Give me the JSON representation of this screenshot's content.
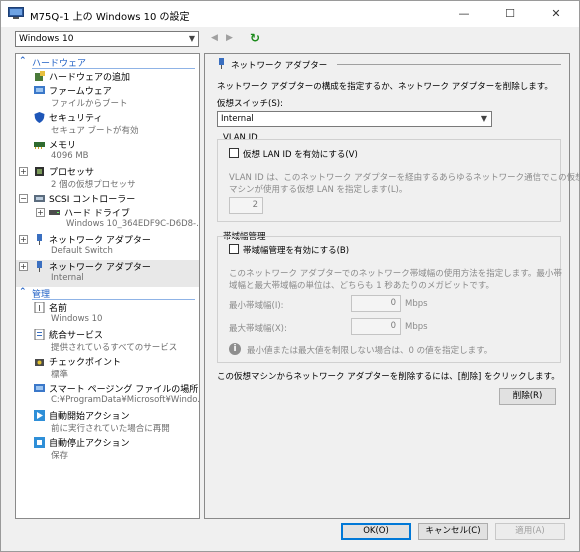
{
  "window": {
    "title": "M75Q-1 上の Windows 10 の設定",
    "min": "—",
    "max": "☐",
    "close": "✕"
  },
  "vm_selector": {
    "value": "Windows 10"
  },
  "nav": {
    "prev": "◀",
    "next": "▶",
    "refresh": "↻"
  },
  "sidebar": {
    "hardware_header": "ハードウェア",
    "management_header": "管理",
    "hardware": [
      {
        "title": "ハードウェアの追加",
        "sub": ""
      },
      {
        "title": "ファームウェア",
        "sub": "ファイルからブート"
      },
      {
        "title": "セキュリティ",
        "sub": "セキュア ブートが有効"
      },
      {
        "title": "メモリ",
        "sub": "4096 MB"
      },
      {
        "title": "プロセッサ",
        "sub": "2 個の仮想プロセッサ"
      },
      {
        "title": "SCSI コントローラー",
        "sub": ""
      },
      {
        "title": "ハード ドライブ",
        "sub": "Windows 10_364EDF9C-D6D8-..."
      },
      {
        "title": "ネットワーク アダプター",
        "sub": "Default Switch"
      },
      {
        "title": "ネットワーク アダプター",
        "sub": "Internal"
      }
    ],
    "management": [
      {
        "title": "名前",
        "sub": "Windows 10"
      },
      {
        "title": "統合サービス",
        "sub": "提供されているすべてのサービス"
      },
      {
        "title": "チェックポイント",
        "sub": "標準"
      },
      {
        "title": "スマート ページング ファイルの場所",
        "sub": "C:¥ProgramData¥Microsoft¥Windo..."
      },
      {
        "title": "自動開始アクション",
        "sub": "前に実行されていた場合に再開"
      },
      {
        "title": "自動停止アクション",
        "sub": "保存"
      }
    ]
  },
  "panel": {
    "header": "ネットワーク アダプター",
    "description": "ネットワーク アダプターの構成を指定するか、ネットワーク アダプターを削除します。",
    "switch_label": "仮想スイッチ(S):",
    "switch_value": "Internal",
    "vlan": {
      "title": "VLAN ID",
      "checkbox": "仮想 LAN ID を有効にする(V)",
      "desc1": "VLAN ID は、このネットワーク アダプターを経由するあらゆるネットワーク通信でこの仮想",
      "desc2": "マシンが使用する仮想 LAN を指定します(L)。",
      "value": "2"
    },
    "bandwidth": {
      "title": "帯域幅管理",
      "checkbox": "帯域幅管理を有効にする(B)",
      "desc1": "このネットワーク アダプターでのネットワーク帯域幅の使用方法を指定します。最小帯",
      "desc2": "域幅と最大帯域幅の単位は、どちらも 1 秒あたりのメガビットです。",
      "min_label": "最小帯域幅(I):",
      "min_value": "0",
      "max_label": "最大帯域幅(X):",
      "max_value": "0",
      "unit": "Mbps",
      "info": "最小値または最大値を制限しない場合は、0 の値を指定します。"
    },
    "remove_text": "この仮想マシンからネットワーク アダプターを削除するには、[削除] をクリックします。",
    "remove_button": "削除(R)"
  },
  "footer": {
    "ok": "OK(O)",
    "cancel": "キャンセル(C)",
    "apply": "適用(A)"
  },
  "colors": {
    "accent": "#1c5ec4",
    "primary_border": "#0078d7"
  }
}
